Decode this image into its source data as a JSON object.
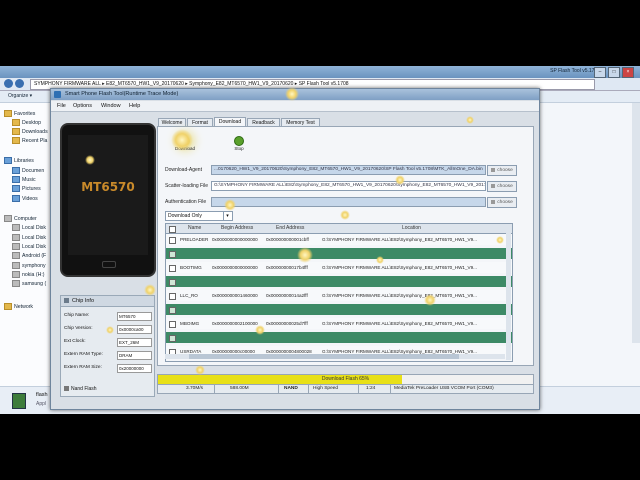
{
  "background_window": {
    "title_right": "SP Flash Tool v5.1708",
    "address_path": "SYMPHONY FIRMWARE ALL ▸ E82_MT6570_HW1_V9_20170620 ▸ Symphony_E82_MT6570_HW1_V9_20170620 ▸ SP Flash Tool v5.1708",
    "toolbar_organize": "Organize ▾",
    "nav": [
      {
        "label": "Favorites",
        "icon": "star-icon"
      },
      {
        "label": "Desktop",
        "icon": "desktop-icon"
      },
      {
        "label": "Downloads",
        "icon": "downloads-icon"
      },
      {
        "label": "Recent Pla",
        "icon": "recent-places-icon"
      },
      {
        "label": "Libraries",
        "icon": "libraries-icon"
      },
      {
        "label": "Documen",
        "icon": "documents-icon"
      },
      {
        "label": "Music",
        "icon": "music-icon"
      },
      {
        "label": "Pictures",
        "icon": "pictures-icon"
      },
      {
        "label": "Videos",
        "icon": "videos-icon"
      },
      {
        "label": "Computer",
        "icon": "computer-icon"
      },
      {
        "label": "Local Disk",
        "icon": "drive-icon"
      },
      {
        "label": "Local Disk",
        "icon": "drive-icon"
      },
      {
        "label": "Local Disk",
        "icon": "drive-icon"
      },
      {
        "label": "Android (F",
        "icon": "drive-icon"
      },
      {
        "label": "symphony",
        "icon": "drive-icon"
      },
      {
        "label": "nokia (H:)",
        "icon": "drive-icon"
      },
      {
        "label": "samsung (",
        "icon": "drive-icon"
      },
      {
        "label": "Network",
        "icon": "network-icon"
      }
    ],
    "details_name": "flash",
    "details_type": "Appl"
  },
  "app": {
    "title": "Smart Phone Flash Tool(Runtime Trace Mode)",
    "menu": [
      "File",
      "Options",
      "Window",
      "Help"
    ],
    "phone_model": "MT6570",
    "chip_info": {
      "header": "Chip Info",
      "rows": [
        {
          "label": "Chip Name:",
          "value": "MT6570"
        },
        {
          "label": "Chip Version:",
          "value": "0x0000ca00"
        },
        {
          "label": "Ext Clock:",
          "value": "EXT_26M"
        },
        {
          "label": "Extern RAM Type:",
          "value": "DRAM"
        },
        {
          "label": "Extern RAM Size:",
          "value": "0x20000000"
        }
      ],
      "flash_label": "Nand Flash"
    },
    "tabs": [
      "Welcome",
      "Format",
      "Download",
      "Readback",
      "Memory Test"
    ],
    "active_tab": "Download",
    "buttons": {
      "download": "Download",
      "stop": "Stop"
    },
    "fields": [
      {
        "label": "Download-Agent",
        "value": "...0170620_HW1_V9_20170620\\Symphony_E82_MT6570_HW1_V9_20170620\\SP Flash Tool v5.1708\\MTK_AllInOne_DA.bin",
        "button": "choose"
      },
      {
        "label": "Scatter-loading File",
        "value": "G:\\SYMPHONY FIRMWARE ALL\\E82\\Symphony_E82_MT6570_HW1_V9_20170620\\Symphony_E82_MT6570_HW1_V9_20170620\\MT6570_Android_scatter.txt",
        "button": "choose"
      },
      {
        "label": "Authentication File",
        "value": "",
        "button": "choose"
      }
    ],
    "download_mode": "Download Only",
    "table": {
      "headers": [
        "Name",
        "Begin Address",
        "End Address",
        "Location"
      ],
      "rows": [
        {
          "name": "PRELOADER",
          "begin": "0x0000000000000000",
          "end": "0x000000000001cbff",
          "location": "G:\\SYMPHONY FIRMWARE ALL\\E82\\Symphony_E82_MT6570_HW1_V9..."
        },
        {
          "name": "",
          "begin": "",
          "end": "",
          "location": ""
        },
        {
          "name": "BOOTIMG",
          "begin": "0x0000000000000000",
          "end": "0x00000000017b4fff",
          "location": "G:\\SYMPHONY FIRMWARE ALL\\E82\\Symphony_E82_MT6570_HW1_V9..."
        },
        {
          "name": "",
          "begin": "",
          "end": "",
          "location": ""
        },
        {
          "name": "LLC_RO",
          "begin": "0x0000000001460000",
          "end": "0x00000000014a2fff",
          "location": "G:\\SYMPHONY FIRMWARE ALL\\E82\\Symphony_E82_MT6570_HW1_V9..."
        },
        {
          "name": "",
          "begin": "",
          "end": "",
          "location": ""
        },
        {
          "name": "MBOIMG",
          "begin": "0x0000000002100000",
          "end": "0x00000000025d7fff",
          "location": "G:\\SYMPHONY FIRMWARE ALL\\E82\\Symphony_E82_MT6570_HW1_V9..."
        },
        {
          "name": "",
          "begin": "",
          "end": "",
          "location": ""
        },
        {
          "name": "USRDATA",
          "begin": "0x000000000c00000",
          "end": "0x0000000004800028",
          "location": "G:\\SYMPHONY FIRMWARE ALL\\E82\\Symphony_E82_MT6570_HW1_V9..."
        }
      ]
    },
    "progress": {
      "text": "Download Flash 65%",
      "fraction": 0.65,
      "color": "#e8e017"
    },
    "status": [
      "3.70M/s",
      "588.00M",
      "NAND",
      "High Speed",
      "1:24",
      "MediaTek PreLoader USB VCOM Port (COM3)"
    ]
  }
}
